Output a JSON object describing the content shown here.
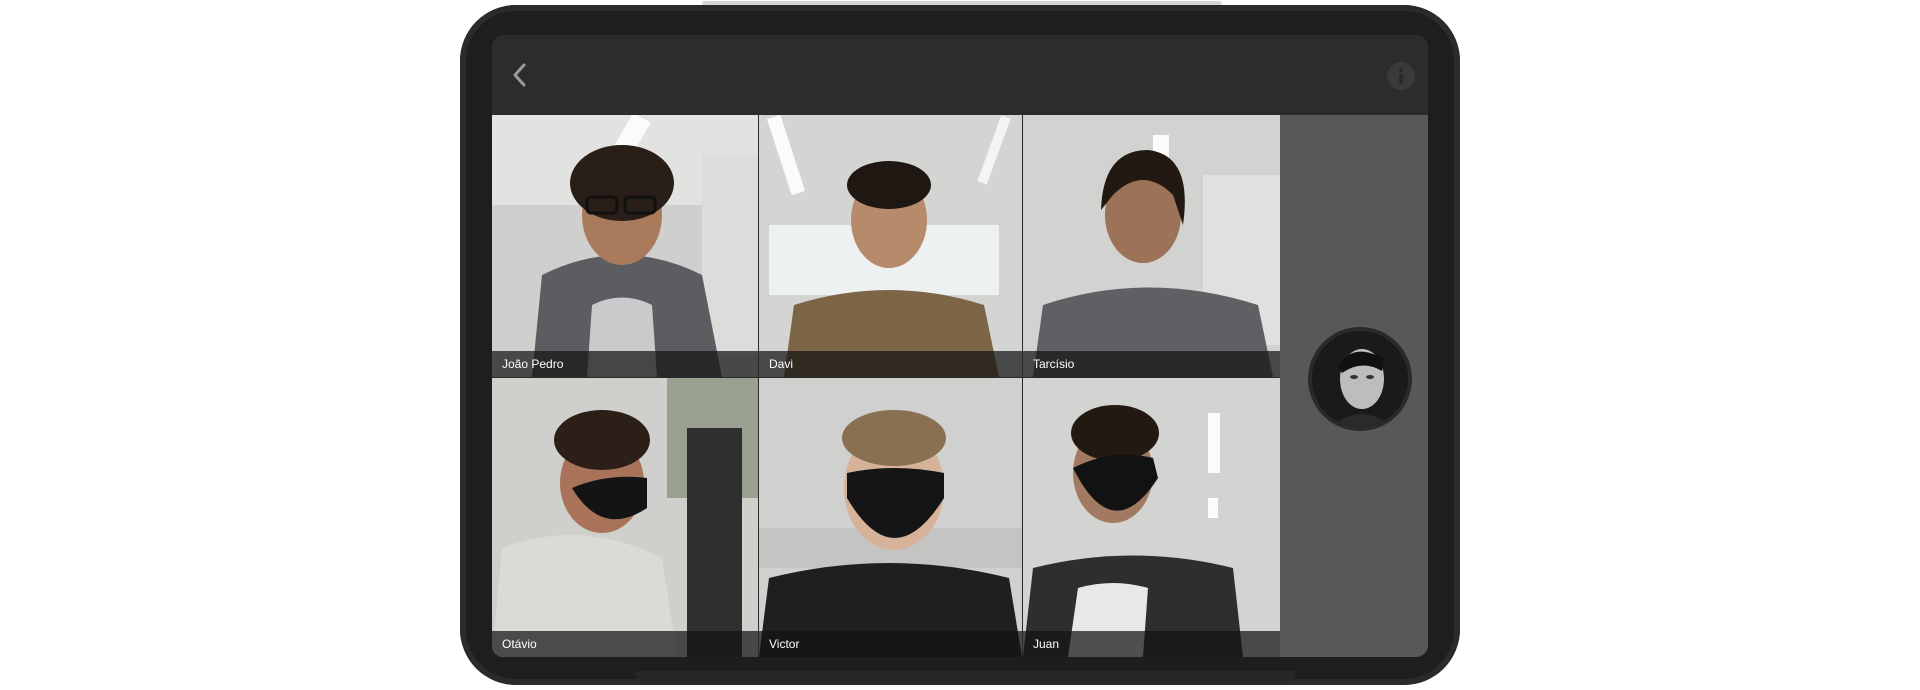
{
  "topbar": {
    "back_icon": "chevron-left-icon",
    "info_icon": "info-icon"
  },
  "participants": [
    {
      "name": "João Pedro"
    },
    {
      "name": "Davi"
    },
    {
      "name": "Tarcísio"
    },
    {
      "name": "Otávio"
    },
    {
      "name": "Victor"
    },
    {
      "name": "Juan"
    }
  ],
  "side_panel": {
    "avatar_icon": "user-avatar"
  },
  "colors": {
    "bezel": "#1e1e1e",
    "topbar": "#2c2c2c",
    "side_panel": "#585858",
    "nameplate": "#141414"
  }
}
